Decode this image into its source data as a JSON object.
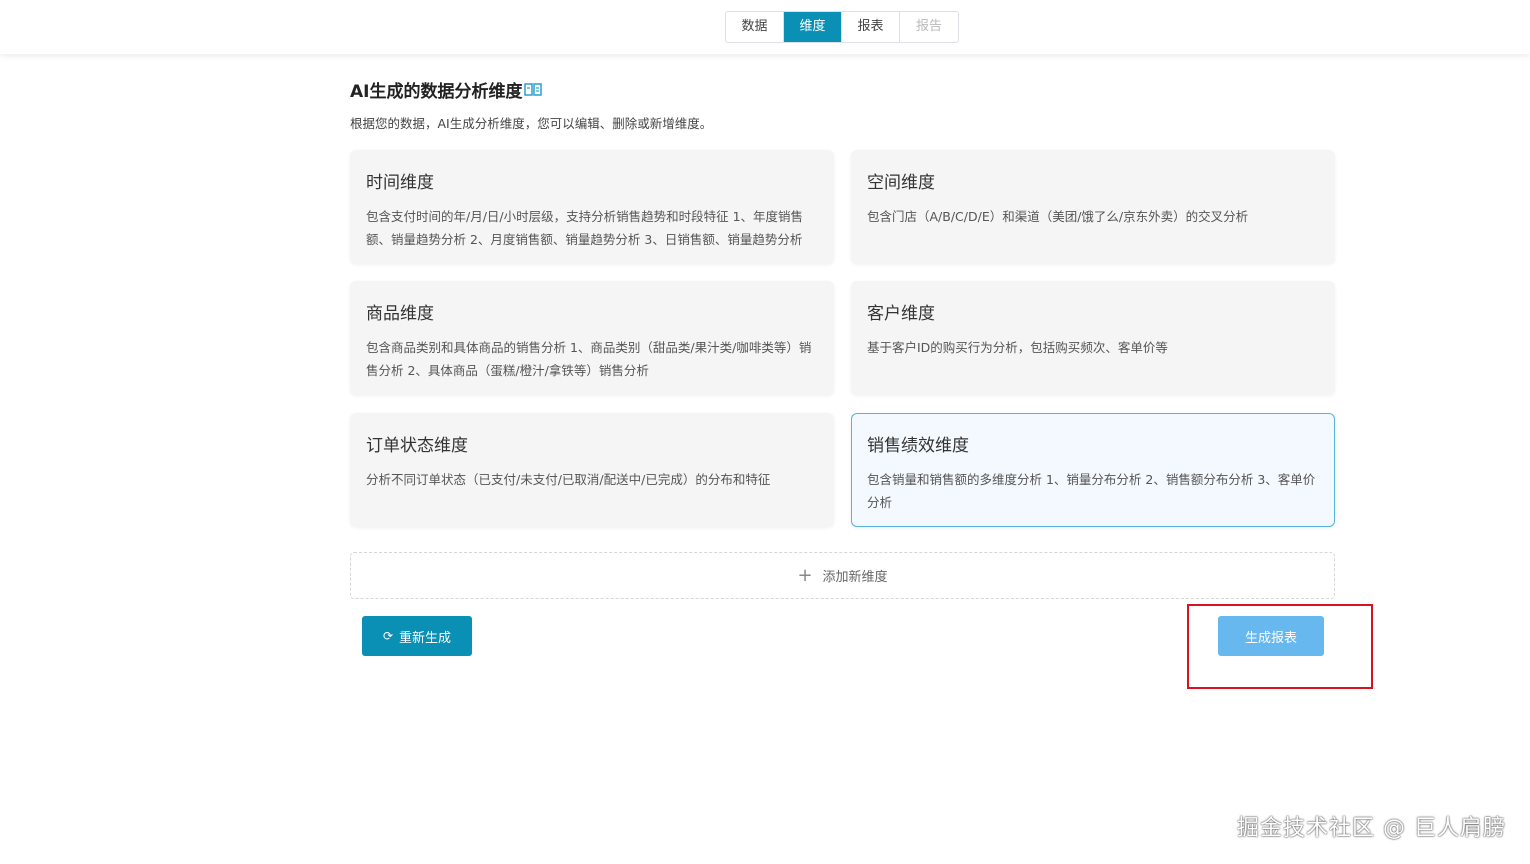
{
  "tabs": [
    {
      "label": "数据",
      "state": "normal"
    },
    {
      "label": "维度",
      "state": "active"
    },
    {
      "label": "报表",
      "state": "normal"
    },
    {
      "label": "报告",
      "state": "disabled"
    }
  ],
  "header": {
    "title": "AI生成的数据分析维度",
    "title_icon": "book-icon",
    "subtitle": "根据您的数据，AI生成分析维度，您可以编辑、删除或新增维度。"
  },
  "dimensions": [
    {
      "title": "时间维度",
      "desc": "包含支付时间的年/月/日/小时层级，支持分析销售趋势和时段特征 1、年度销售额、销量趋势分析 2、月度销售额、销量趋势分析 3、日销售额、销量趋势分析"
    },
    {
      "title": "空间维度",
      "desc": "包含门店（A/B/C/D/E）和渠道（美团/饿了么/京东外卖）的交叉分析"
    },
    {
      "title": "商品维度",
      "desc": "包含商品类别和具体商品的销售分析 1、商品类别（甜品类/果汁类/咖啡类等）销售分析 2、具体商品（蛋糕/橙汁/拿铁等）销售分析"
    },
    {
      "title": "客户维度",
      "desc": "基于客户ID的购买行为分析，包括购买频次、客单价等"
    },
    {
      "title": "订单状态维度",
      "desc": "分析不同订单状态（已支付/未支付/已取消/配送中/已完成）的分布和特征"
    },
    {
      "title": "销售绩效维度",
      "desc": "包含销量和销售额的多维度分析 1、销量分布分析 2、销售额分布分析 3、客单价分析",
      "selected": true
    }
  ],
  "add_label": "添加新维度",
  "buttons": {
    "regenerate": "重新生成",
    "generate_report": "生成报表"
  },
  "watermark": "掘金技术社区 @ 巨人肩膀",
  "colors": {
    "primary": "#0a8fb5",
    "generate": "#66b8ef",
    "highlight": "#d9121f"
  }
}
